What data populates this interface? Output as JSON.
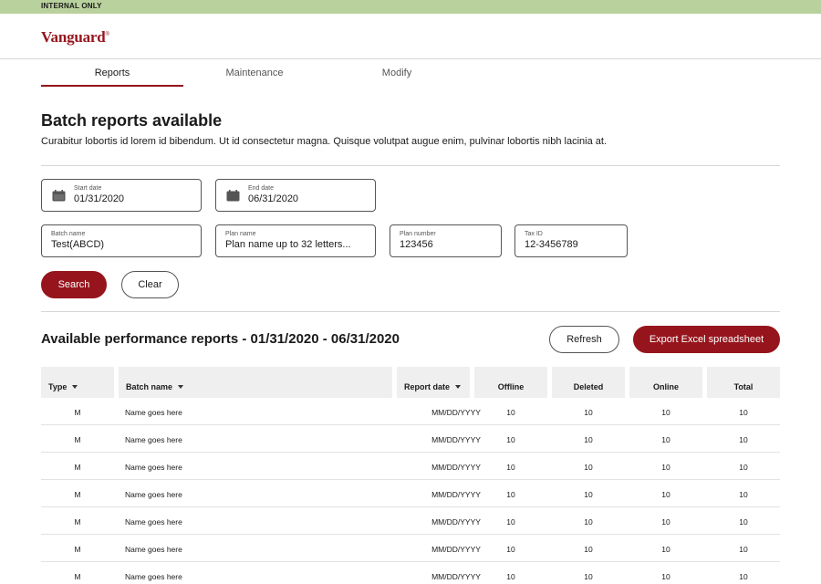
{
  "banner": {
    "text": "INTERNAL ONLY"
  },
  "brand": {
    "name": "Vanguard",
    "mark": "®",
    "color": "#96151d"
  },
  "tabs": [
    {
      "label": "Reports",
      "active": true
    },
    {
      "label": "Maintenance",
      "active": false
    },
    {
      "label": "Modify",
      "active": false
    }
  ],
  "page": {
    "title": "Batch reports available",
    "description": "Curabitur lobortis id lorem id bibendum. Ut id consectetur magna. Quisque volutpat augue enim, pulvinar lobortis nibh lacinia at."
  },
  "filters": {
    "start_date": {
      "label": "Start date",
      "value": "01/31/2020",
      "icon": "calendar-icon"
    },
    "end_date": {
      "label": "End date",
      "value": "06/31/2020",
      "icon": "calendar-icon"
    },
    "batch_name": {
      "label": "Batch name",
      "value": "Test(ABCD)"
    },
    "plan_name": {
      "label": "Plan name",
      "value": "Plan name up to 32 letters..."
    },
    "plan_number": {
      "label": "Plan number",
      "value": "123456"
    },
    "tax_id": {
      "label": "Tax ID",
      "value": "12-3456789"
    },
    "search_label": "Search",
    "clear_label": "Clear"
  },
  "results": {
    "title": "Available performance reports - 01/31/2020 - 06/31/2020",
    "refresh_label": "Refresh",
    "export_label": "Export Excel spreadsheet",
    "columns": [
      {
        "label": "Type",
        "sortable": true
      },
      {
        "label": "Batch name",
        "sortable": true
      },
      {
        "label": "Report date",
        "sortable": true
      },
      {
        "label": "Offline",
        "sortable": false
      },
      {
        "label": "Deleted",
        "sortable": false
      },
      {
        "label": "Online",
        "sortable": false
      },
      {
        "label": "Total",
        "sortable": false
      }
    ],
    "rows": [
      [
        "M",
        "Name goes here",
        "MM/DD/YYYY",
        "10",
        "10",
        "10",
        "10"
      ],
      [
        "M",
        "Name goes here",
        "MM/DD/YYYY",
        "10",
        "10",
        "10",
        "10"
      ],
      [
        "M",
        "Name goes here",
        "MM/DD/YYYY",
        "10",
        "10",
        "10",
        "10"
      ],
      [
        "M",
        "Name goes here",
        "MM/DD/YYYY",
        "10",
        "10",
        "10",
        "10"
      ],
      [
        "M",
        "Name goes here",
        "MM/DD/YYYY",
        "10",
        "10",
        "10",
        "10"
      ],
      [
        "M",
        "Name goes here",
        "MM/DD/YYYY",
        "10",
        "10",
        "10",
        "10"
      ],
      [
        "M",
        "Name goes here",
        "MM/DD/YYYY",
        "10",
        "10",
        "10",
        "10"
      ]
    ]
  },
  "colors": {
    "accent": "#96151d",
    "banner": "#b9d19c",
    "header_bg": "#efefef"
  }
}
